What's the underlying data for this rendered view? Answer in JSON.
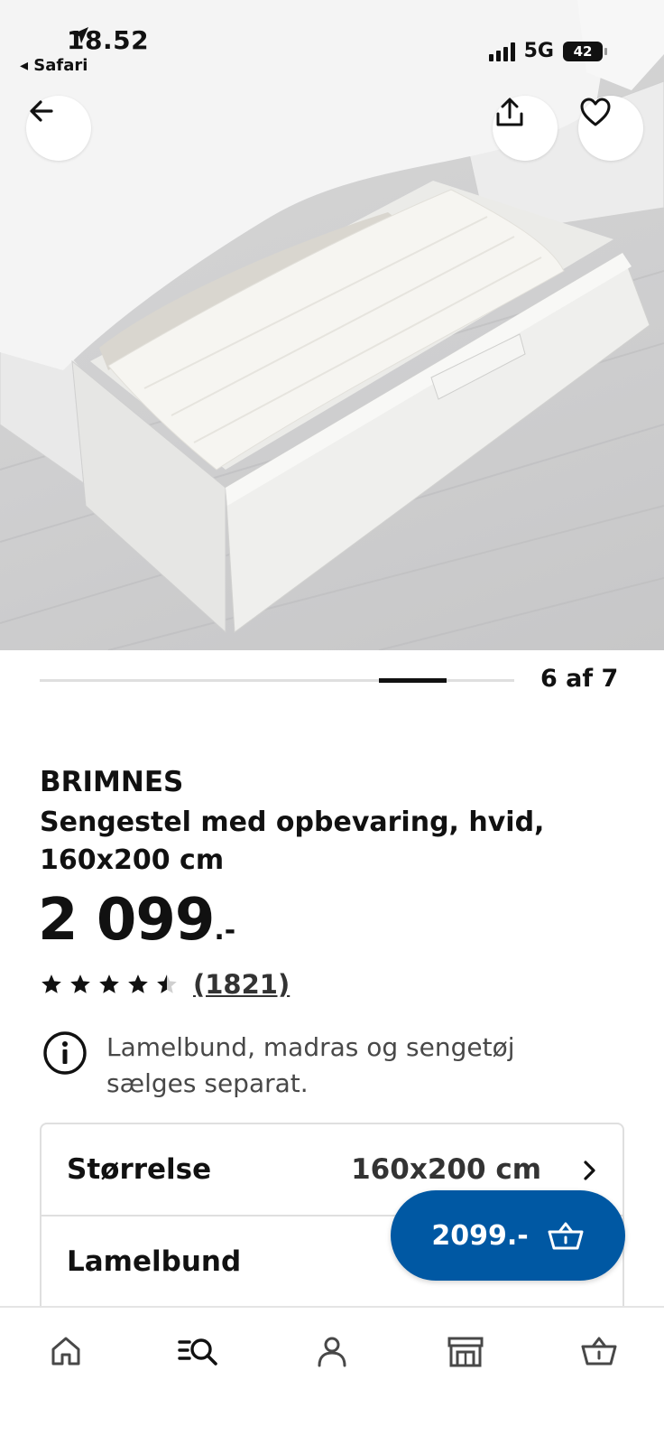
{
  "status_bar": {
    "time": "18.52",
    "back_app": "◂ Safari",
    "network": "5G",
    "battery": "42"
  },
  "hero": {
    "icons": [
      "arrow-left-icon",
      "share-icon",
      "heart-icon"
    ]
  },
  "carousel": {
    "counter": "6 af 7",
    "current": 6,
    "total": 7
  },
  "product": {
    "brand": "BRIMNES",
    "description": "Sengestel med opbevaring, hvid, 160x200 cm",
    "price": "2 099",
    "price_suffix": ".-",
    "rating": 4.5,
    "reviews": "(1821)",
    "notice": "Lamelbund, madras og sengetøj sælges separat."
  },
  "options": {
    "size_label": "Størrelse",
    "size_value": "160x200 cm",
    "slats_label": "Lamelbund"
  },
  "cart_button": {
    "price": "2099.-",
    "color": "#0058a3"
  },
  "bottom_nav": {
    "items": [
      "home-icon",
      "search-icon",
      "profile-icon",
      "store-icon",
      "basket-icon"
    ]
  }
}
